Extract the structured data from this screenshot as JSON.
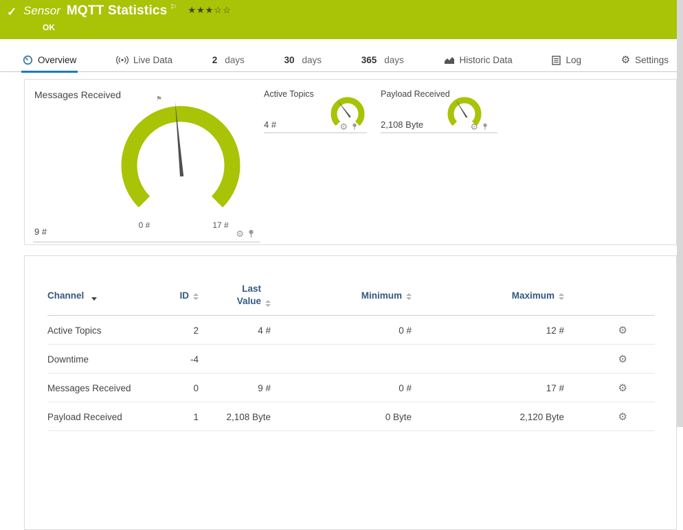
{
  "colors": {
    "brand_green": "#a9c306",
    "accent_blue": "#1e7ab7"
  },
  "icons": {
    "check": "✓",
    "flag": "⚐",
    "gear": "⚙",
    "marker_flag": "⚑"
  },
  "header": {
    "type_label": "Sensor",
    "title": "MQTT Statistics",
    "rating_stars": "★★★☆☆",
    "status": "OK"
  },
  "tabs": {
    "overview": {
      "label": "Overview"
    },
    "live": {
      "label": "Live Data"
    },
    "d2": {
      "value": "2",
      "unit": "days"
    },
    "d30": {
      "value": "30",
      "unit": "days"
    },
    "d365": {
      "value": "365",
      "unit": "days"
    },
    "historic": {
      "label": "Historic Data"
    },
    "log": {
      "label": "Log"
    },
    "settings": {
      "label": "Settings"
    }
  },
  "gauges": {
    "messages": {
      "title": "Messages Received",
      "value": "9 #",
      "scale_min": "0 #",
      "scale_max": "17 #"
    },
    "active_topics": {
      "title": "Active Topics",
      "value": "4 #"
    },
    "payload": {
      "title": "Payload Received",
      "value": "2,108 Byte"
    }
  },
  "table": {
    "headers": {
      "channel": "Channel",
      "id": "ID",
      "last_value": "Last Value",
      "minimum": "Minimum",
      "maximum": "Maximum"
    },
    "rows": [
      {
        "channel": "Active Topics",
        "id": "2",
        "last_value": "4 #",
        "minimum": "0 #",
        "maximum": "12 #"
      },
      {
        "channel": "Downtime",
        "id": "-4",
        "last_value": "",
        "minimum": "",
        "maximum": ""
      },
      {
        "channel": "Messages Received",
        "id": "0",
        "last_value": "9 #",
        "minimum": "0 #",
        "maximum": "17 #"
      },
      {
        "channel": "Payload Received",
        "id": "1",
        "last_value": "2,108 Byte",
        "minimum": "0 Byte",
        "maximum": "2,120 Byte"
      }
    ]
  }
}
